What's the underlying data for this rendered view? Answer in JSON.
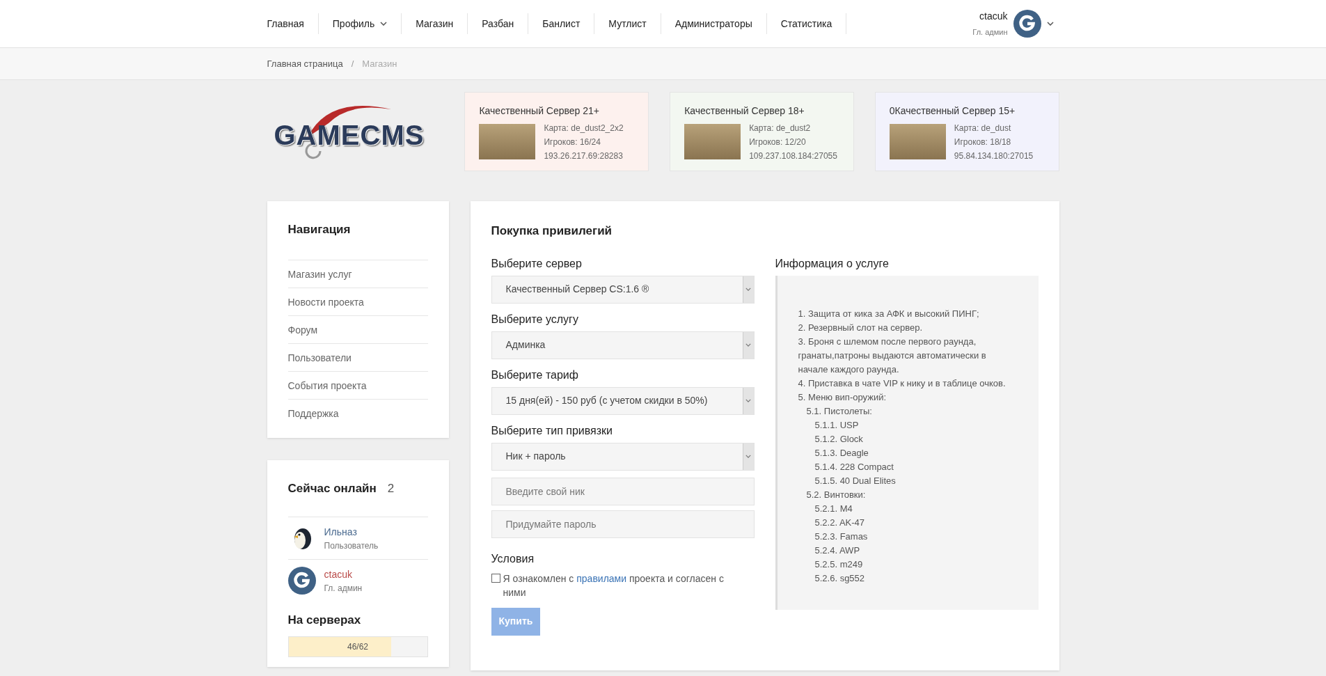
{
  "header": {
    "menu": [
      {
        "label": "Главная",
        "dropdown": false
      },
      {
        "label": "Профиль",
        "dropdown": true
      },
      {
        "label": "Магазин",
        "dropdown": false
      },
      {
        "label": "Разбан",
        "dropdown": false
      },
      {
        "label": "Банлист",
        "dropdown": false
      },
      {
        "label": "Мутлист",
        "dropdown": false
      },
      {
        "label": "Администраторы",
        "dropdown": false
      },
      {
        "label": "Статистика",
        "dropdown": false
      }
    ],
    "user": {
      "name": "ctacuk",
      "role": "Гл. админ"
    }
  },
  "breadcrumb_separator": "/",
  "breadcrumbs": [
    {
      "label": "Главная страница",
      "current": false
    },
    {
      "label": "Магазин",
      "current": true
    }
  ],
  "logo": {
    "text": "GAMECMS"
  },
  "servers": [
    {
      "name": "Качественный Сервер 21+",
      "map": "Карта: de_dust2_2x2",
      "players": "Игроков: 16/24",
      "address": "193.26.217.69:28283",
      "color": "#fdf1ee"
    },
    {
      "name": "Качественный Сервер 18+",
      "map": "Карта: de_dust2",
      "players": "Игроков: 12/20",
      "address": "109.237.108.184:27055",
      "color": "#f3f7f1"
    },
    {
      "name": "0Качественный Сервер 15+",
      "map": "Карта: de_dust",
      "players": "Игроков: 18/18",
      "address": "95.84.134.180:27015",
      "color": "#f2f2fc"
    }
  ],
  "navigation": {
    "title": "Навигация",
    "items": [
      "Магазин услуг",
      "Новости проекта",
      "Форум",
      "Пользователи",
      "События проекта",
      "Поддержка"
    ]
  },
  "online": {
    "title": "Сейчас онлайн",
    "count": "2",
    "users": [
      {
        "name": "Ильназ",
        "role": "Пользователь",
        "kind": "penguin",
        "color": "#4a6a8f"
      },
      {
        "name": "ctacuk",
        "role": "Гл. админ",
        "kind": "logo",
        "color": "#b94a48"
      }
    ],
    "on_servers": {
      "title": "На серверах",
      "reading": "46/62",
      "level": 0.74
    }
  },
  "purchase": {
    "title": "Покупка привилегий",
    "fields": [
      {
        "kind": "select",
        "label": "Выберите сервер",
        "value": "Качественный Сервер CS:1.6 ®"
      },
      {
        "kind": "select",
        "label": "Выберите услугу",
        "value": "Админка"
      },
      {
        "kind": "select",
        "label": "Выберите тариф",
        "value": "15 дня(ей) - 150 руб (с учетом скидки в 50%)"
      },
      {
        "kind": "select",
        "label": "Выберите тип привязки",
        "value": "Ник + пароль"
      },
      {
        "kind": "input",
        "placeholder": "Введите свой ник"
      },
      {
        "kind": "input",
        "placeholder": "Придумайте пароль"
      }
    ],
    "terms": {
      "title": "Условия",
      "checked": false,
      "before": "Я ознакомлен с",
      "link": "правилами",
      "after": "проекта и согласен с ними"
    },
    "buy": {
      "label": "Купить",
      "disabled": true
    },
    "info": {
      "title": "Информация о услуге",
      "items": [
        {
          "text": "1. Защита от кика за АФК и высокий ПИНГ;"
        },
        {
          "text": "2. Резервный слот на сервер."
        },
        {
          "text": "3. Броня с шлемом после первого раунда, гранаты,патроны выдаются автоматически в начале каждого раунда."
        },
        {
          "text": "4. Приставка в чате VIP к нику и в таблице очков."
        },
        {
          "text": "5. Меню вип-оружий:",
          "children": [
            {
              "text": "5.1. Пистолеты:",
              "children": [
                {
                  "text": "5.1.1. USP"
                },
                {
                  "text": "5.1.2. Glock"
                },
                {
                  "text": "5.1.3. Deagle"
                },
                {
                  "text": "5.1.4. 228 Compact"
                },
                {
                  "text": "5.1.5. 40 Dual Elites"
                }
              ]
            },
            {
              "text": "5.2. Винтовки:",
              "children": [
                {
                  "text": "5.2.1. M4"
                },
                {
                  "text": "5.2.2. AK-47"
                },
                {
                  "text": "5.2.3. Famas"
                },
                {
                  "text": "5.2.4. AWP"
                },
                {
                  "text": "5.2.5. m249"
                },
                {
                  "text": "5.2.6. sg552"
                }
              ]
            }
          ]
        }
      ]
    }
  }
}
